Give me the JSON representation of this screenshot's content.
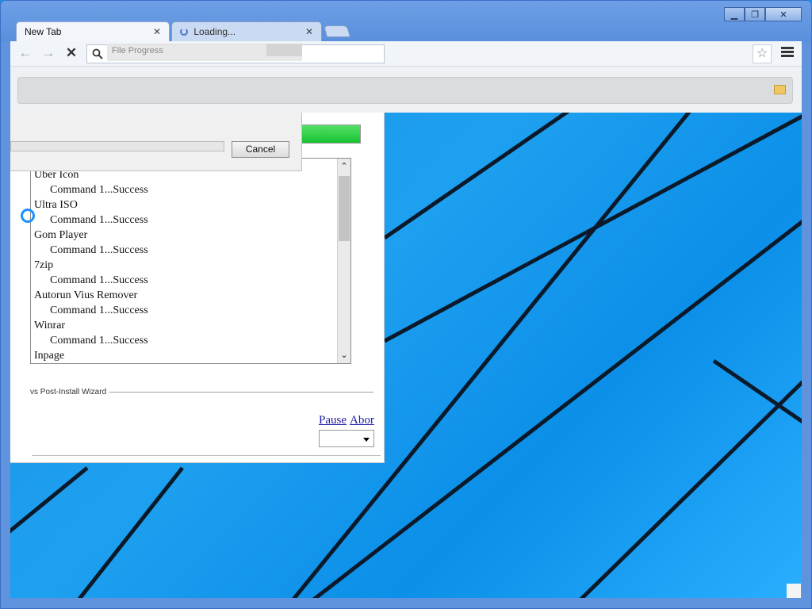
{
  "browser": {
    "tabs": [
      {
        "label": "New Tab",
        "active": true
      },
      {
        "label": "Loading...",
        "active": false
      }
    ],
    "window_controls": {
      "minimize": "▁",
      "maximize": "❐",
      "close": "✕"
    }
  },
  "dialog": {
    "title": "File Progress",
    "cancel_label": "Cancel"
  },
  "log": {
    "items": [
      {
        "text": "Uber Icon",
        "sub": false
      },
      {
        "text": "Command 1...Success",
        "sub": true
      },
      {
        "text": "Ultra ISO",
        "sub": false
      },
      {
        "text": "Command 1...Success",
        "sub": true
      },
      {
        "text": "Gom Player",
        "sub": false
      },
      {
        "text": "Command 1...Success",
        "sub": true
      },
      {
        "text": "7zip",
        "sub": false
      },
      {
        "text": "Command 1...Success",
        "sub": true
      },
      {
        "text": "Autorun Vius Remover",
        "sub": false
      },
      {
        "text": "Command 1...Success",
        "sub": true
      },
      {
        "text": "Winrar",
        "sub": false
      },
      {
        "text": "Command 1...Success",
        "sub": true
      },
      {
        "text": "Inpage",
        "sub": false
      }
    ]
  },
  "wizard": {
    "section_label": "vs Post-Install Wizard",
    "pause_label": "Pause",
    "abort_label": "Abor"
  },
  "colors": {
    "accent_progress": "#18c231",
    "link": "#1a1aa6",
    "desktop": "#1ea0f0"
  }
}
